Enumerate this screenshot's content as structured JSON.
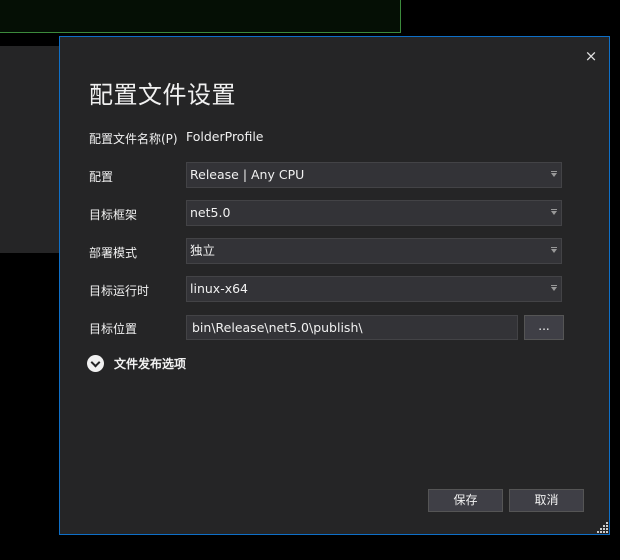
{
  "dialog": {
    "title": "配置文件设置",
    "close_icon": "×",
    "profile_name_label": "配置文件名称(P)",
    "profile_name_value": "FolderProfile",
    "fields": [
      {
        "label": "配置",
        "value": "Release | Any CPU"
      },
      {
        "label": "目标框架",
        "value": "net5.0"
      },
      {
        "label": "部署模式",
        "value": "独立"
      },
      {
        "label": "目标运行时",
        "value": "linux-x64"
      }
    ],
    "target_location": {
      "label": "目标位置",
      "value": "bin\\Release\\net5.0\\publish\\",
      "browse_label": "..."
    },
    "expander_label": "文件发布选项",
    "save_label": "保存",
    "cancel_label": "取消"
  },
  "colors": {
    "accent_border": "#0e6fc7",
    "background": "#252526"
  }
}
